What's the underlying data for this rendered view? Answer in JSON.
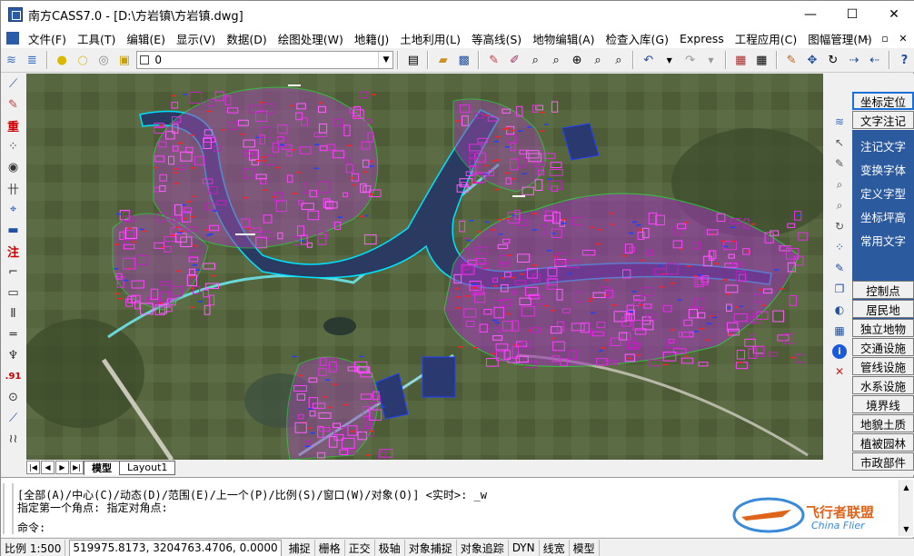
{
  "app": {
    "title": "南方CASS7.0 - [D:\\方岩镇\\方岩镇.dwg]",
    "window_controls": [
      "—",
      "☐",
      "✕"
    ]
  },
  "menu": [
    "文件(F)",
    "工具(T)",
    "编辑(E)",
    "显示(V)",
    "数据(D)",
    "绘图处理(W)",
    "地籍(J)",
    "土地利用(L)",
    "等高线(S)",
    "地物编辑(A)",
    "检查入库(G)",
    "Express",
    "工程应用(C)",
    "图幅管理(M)"
  ],
  "mdi_controls": [
    "–",
    "▫",
    "✕"
  ],
  "toolbar": {
    "layer_value": "0"
  },
  "left_tools": [
    {
      "icon": "polyline-icon",
      "glyph": "⟋"
    },
    {
      "icon": "pen-icon",
      "glyph": "✎"
    },
    {
      "icon": "heavy-char-icon",
      "glyph": "重"
    },
    {
      "icon": "grid-dots-icon",
      "glyph": "⁘"
    },
    {
      "icon": "camera-icon",
      "glyph": "◉"
    },
    {
      "icon": "fence-icon",
      "glyph": "卄"
    },
    {
      "icon": "map-icon",
      "glyph": "⌖"
    },
    {
      "icon": "ruler-icon",
      "glyph": "▬"
    },
    {
      "icon": "annotate-icon",
      "glyph": "注"
    },
    {
      "icon": "corner-icon",
      "glyph": "⌐"
    },
    {
      "icon": "rectangle-icon",
      "glyph": "▭"
    },
    {
      "icon": "rail-icon",
      "glyph": "Ⅱ"
    },
    {
      "icon": "double-line-icon",
      "glyph": "═"
    },
    {
      "icon": "tree-icon",
      "glyph": "♆"
    },
    {
      "icon": "elevation-point-icon",
      "glyph": ".91"
    },
    {
      "icon": "circle-point-icon",
      "glyph": "⊙"
    },
    {
      "icon": "line-segment-icon",
      "glyph": "⟋"
    },
    {
      "icon": "wave-icon",
      "glyph": "≀≀"
    }
  ],
  "right_panel": {
    "top_buttons": [
      "坐标定位",
      "文字注记"
    ],
    "blue_items": [
      "注记文字",
      "变换字体",
      "定义字型",
      "坐标坪高",
      "常用文字"
    ],
    "category_buttons": [
      "控制点",
      "居民地",
      "独立地物",
      "交通设施",
      "管线设施",
      "水系设施",
      "境界线",
      "地貌土质",
      "植被园林",
      "市政部件"
    ]
  },
  "layout_tabs": [
    "模型",
    "Layout1"
  ],
  "command": {
    "lines": [
      "[全部(A)/中心(C)/动态(D)/范围(E)/上一个(P)/比例(S)/窗口(W)/对象(O)] <实时>: _w",
      "指定第一个角点: 指定对角点:",
      "命令:"
    ]
  },
  "watermark": {
    "cn": "飞行者联盟",
    "en": "China Flier"
  },
  "status": {
    "scale": "比例 1:500",
    "coords": "519975.8173, 3204763.4706, 0.0000",
    "toggles": [
      "捕捉",
      "栅格",
      "正交",
      "极轴",
      "对象捕捉",
      "对象追踪",
      "DYN",
      "线宽",
      "模型"
    ]
  }
}
